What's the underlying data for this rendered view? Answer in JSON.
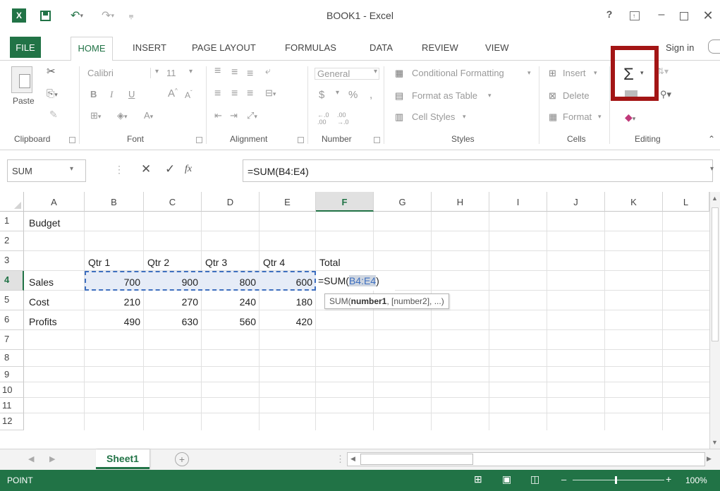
{
  "window": {
    "title": "BOOK1 - Excel",
    "help": "?",
    "sign_in": "Sign in"
  },
  "tabs": [
    "FILE",
    "HOME",
    "INSERT",
    "PAGE LAYOUT",
    "FORMULAS",
    "DATA",
    "REVIEW",
    "VIEW"
  ],
  "ribbon": {
    "clipboard": {
      "label": "Clipboard",
      "paste": "Paste"
    },
    "font": {
      "label": "Font",
      "name": "Calibri",
      "size": "11",
      "bold": "B",
      "italic": "I",
      "underline": "U"
    },
    "alignment": {
      "label": "Alignment"
    },
    "number": {
      "label": "Number",
      "format": "General",
      "currency": "$",
      "percent": "%",
      "comma": ","
    },
    "styles": {
      "label": "Styles",
      "conditional": "Conditional Formatting",
      "table": "Format as Table",
      "cell_styles": "Cell Styles"
    },
    "cells": {
      "label": "Cells",
      "insert": "Insert",
      "delete": "Delete",
      "format": "Format"
    },
    "editing": {
      "label": "Editing",
      "autosum": "Σ"
    },
    "highlight_color": "#a31515"
  },
  "formula_bar": {
    "name_box": "SUM",
    "fx": "fx",
    "formula": "=SUM(B4:E4)"
  },
  "columns": [
    "A",
    "B",
    "C",
    "D",
    "E",
    "F",
    "G",
    "H",
    "I",
    "J",
    "K",
    "L"
  ],
  "rows": [
    "1",
    "2",
    "3",
    "4",
    "5",
    "6",
    "7",
    "8",
    "9",
    "10",
    "11",
    "12"
  ],
  "cells": {
    "A1": "Budget",
    "B3": "Qtr 1",
    "C3": "Qtr 2",
    "D3": "Qtr 3",
    "E3": "Qtr 4",
    "F3": "Total",
    "A4": "Sales",
    "B4": "700",
    "C4": "900",
    "D4": "800",
    "E4": "600",
    "A5": "Cost",
    "B5": "210",
    "C5": "270",
    "D5": "240",
    "E5": "180",
    "A6": "Profits",
    "B6": "490",
    "C6": "630",
    "D6": "560",
    "E6": "420"
  },
  "editing_cell": {
    "prefix": "=SUM(",
    "ref": "B4:E4",
    "suffix": ")"
  },
  "tooltip": {
    "fn": "SUM(",
    "arg1": "number1",
    "rest": ", [number2], ...)"
  },
  "sheet": {
    "tab": "Sheet1",
    "add": "+"
  },
  "status": {
    "mode": "POINT",
    "zoom": "100%"
  },
  "accent": "#217346"
}
